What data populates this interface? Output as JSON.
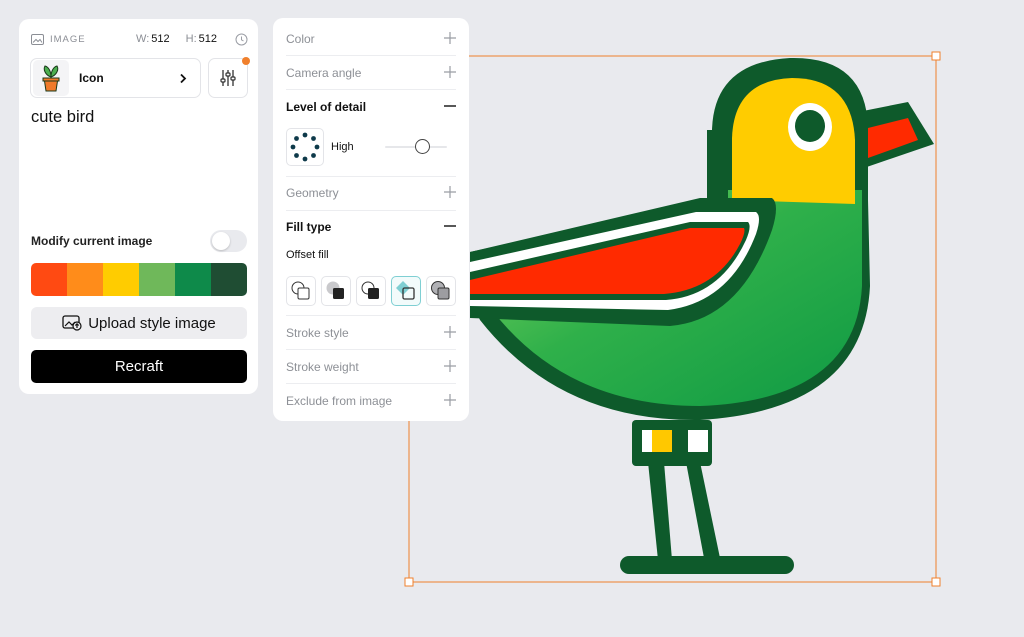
{
  "image_header": {
    "label": "IMAGE",
    "width_label": "W:",
    "width_value": "512",
    "height_label": "H:",
    "height_value": "512"
  },
  "style": {
    "name": "Icon"
  },
  "prompt": "cute bird",
  "modify": {
    "label": "Modify current image",
    "enabled": false
  },
  "palette": [
    "#ff4a12",
    "#ff8c1a",
    "#ffcc00",
    "#6fb85a",
    "#0e8a4a",
    "#1f4d33"
  ],
  "upload_label": "Upload style image",
  "recraft_label": "Recraft",
  "settings": {
    "color": "Color",
    "camera_angle": "Camera angle",
    "level_of_detail": "Level of detail",
    "detail_value": "High",
    "detail_level": 0.6,
    "geometry": "Geometry",
    "fill_type": "Fill type",
    "fill_value": "Offset fill",
    "stroke_style": "Stroke style",
    "stroke_weight": "Stroke weight",
    "exclude": "Exclude from image"
  },
  "colors": {
    "accent": "#f0802c",
    "selection": "#f0802c"
  }
}
